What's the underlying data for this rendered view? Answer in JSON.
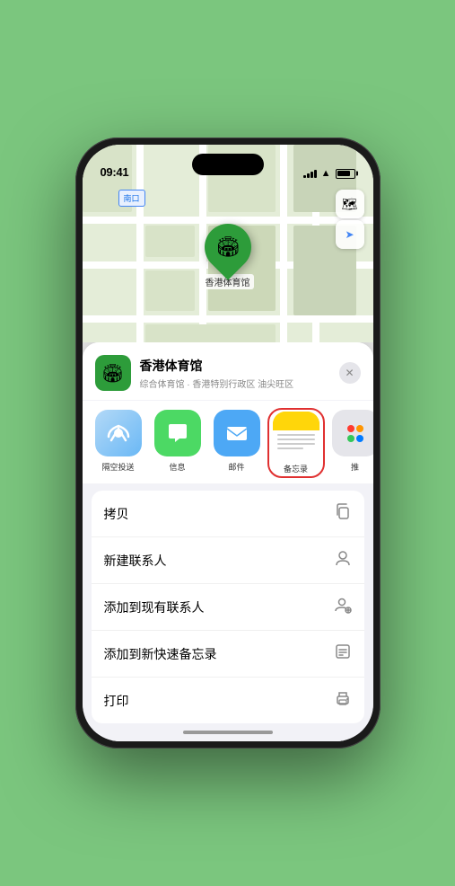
{
  "status": {
    "time": "09:41",
    "signal": [
      3,
      5,
      7,
      9,
      11
    ],
    "battery_level": "85%"
  },
  "map": {
    "entrance_label": "南口",
    "pin_label": "香港体育馆",
    "controls": {
      "map_icon": "🗺",
      "location_icon": "➤"
    }
  },
  "venue_card": {
    "name": "香港体育馆",
    "subtitle": "综合体育馆 · 香港特别行政区 油尖旺区",
    "close_label": "✕"
  },
  "share_items": [
    {
      "id": "airdrop",
      "icon": "📡",
      "label": "隔空投送",
      "type": "airdrop"
    },
    {
      "id": "messages",
      "icon": "💬",
      "label": "信息",
      "type": "messages"
    },
    {
      "id": "mail",
      "icon": "✉",
      "label": "邮件",
      "type": "mail"
    },
    {
      "id": "notes",
      "icon": "",
      "label": "备忘录",
      "type": "notes"
    },
    {
      "id": "more",
      "icon": "⋯",
      "label": "推",
      "type": "more-apps"
    }
  ],
  "action_items": [
    {
      "id": "copy",
      "label": "拷贝",
      "icon": "⧉"
    },
    {
      "id": "new-contact",
      "label": "新建联系人",
      "icon": "👤"
    },
    {
      "id": "add-existing",
      "label": "添加到现有联系人",
      "icon": "👤"
    },
    {
      "id": "add-notes",
      "label": "添加到新快速备忘录",
      "icon": "🗒"
    },
    {
      "id": "print",
      "label": "打印",
      "icon": "🖨"
    }
  ]
}
